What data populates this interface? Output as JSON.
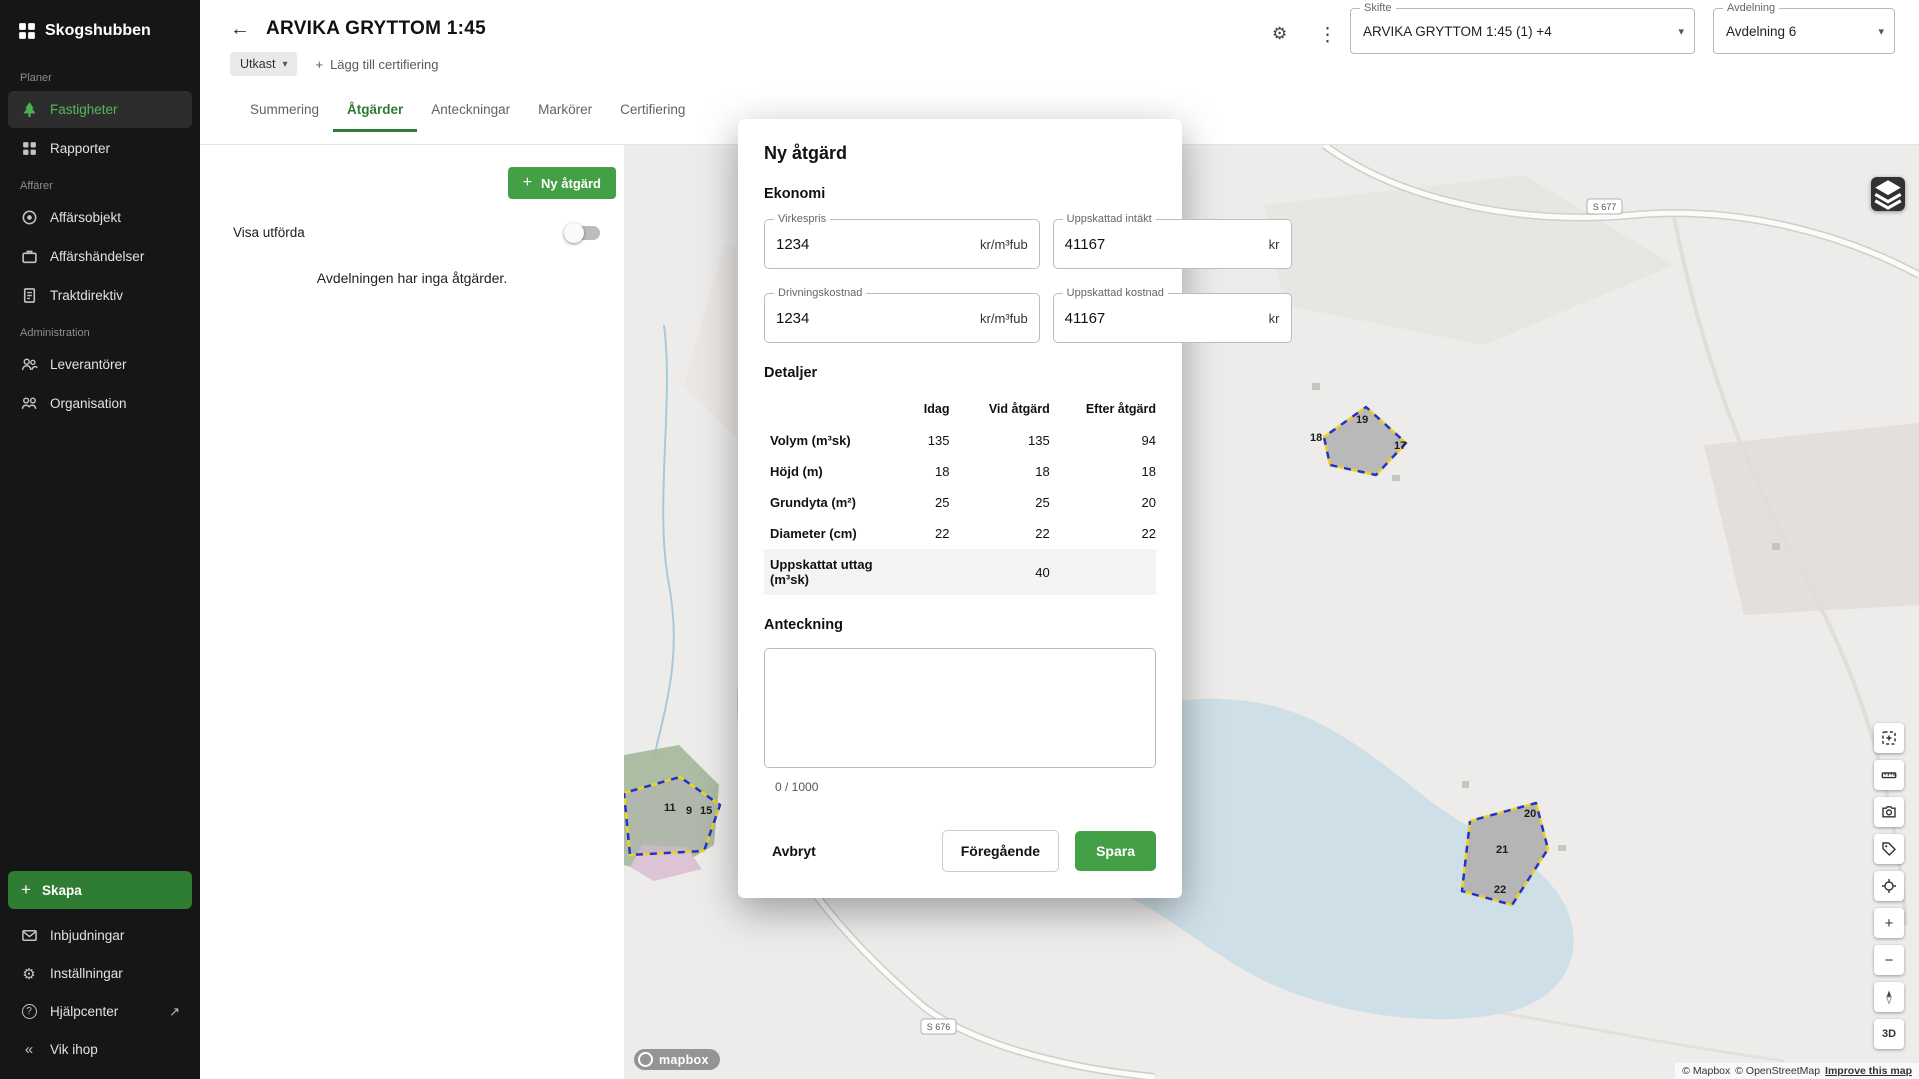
{
  "icons": {
    "back": "←",
    "more": "⋮",
    "gear": "⚙",
    "caret": "▾",
    "plus": "+",
    "collapse": "«",
    "external": "↗",
    "question": "?",
    "zoom_in": "+",
    "zoom_out": "−"
  },
  "sidebar": {
    "logo": "Skogshubben",
    "sections": [
      {
        "header": "Planer",
        "items": [
          {
            "label": "Fastigheter"
          },
          {
            "label": "Rapporter"
          }
        ]
      },
      {
        "header": "Affärer",
        "items": [
          {
            "label": "Affärsobjekt"
          },
          {
            "label": "Affärshändelser"
          },
          {
            "label": "Traktdirektiv"
          }
        ]
      },
      {
        "header": "Administration",
        "items": [
          {
            "label": "Leverantörer"
          },
          {
            "label": "Organisation"
          }
        ]
      }
    ],
    "create_button": "Skapa",
    "footer_items": [
      {
        "label": "Inbjudningar"
      },
      {
        "label": "Inställningar"
      },
      {
        "label": "Hjälpcenter"
      },
      {
        "label": "Vik ihop"
      }
    ]
  },
  "header": {
    "title": "ARVIKA GRYTTOM 1:45",
    "status": "Utkast",
    "add_certification": "Lägg till certifiering",
    "tabs": [
      {
        "label": "Summering"
      },
      {
        "label": "Åtgärder"
      },
      {
        "label": "Anteckningar"
      },
      {
        "label": "Markörer"
      },
      {
        "label": "Certifiering"
      }
    ],
    "skifte": {
      "label": "Skifte",
      "value": "ARVIKA GRYTTOM 1:45 (1) +4"
    },
    "avdelning": {
      "label": "Avdelning",
      "value": "Avdelning 6"
    }
  },
  "panel": {
    "new_action": "Ny åtgärd",
    "show_completed": "Visa utförda",
    "empty": "Avdelningen har inga åtgärder."
  },
  "modal": {
    "title": "Ny åtgärd",
    "economy": {
      "heading": "Ekonomi",
      "fields": [
        {
          "label": "Virkespris",
          "value": "1234",
          "unit": "kr/m³fub"
        },
        {
          "label": "Uppskattad intäkt",
          "value": "41167",
          "unit": "kr"
        },
        {
          "label": "Drivningskostnad",
          "value": "1234",
          "unit": "kr/m³fub"
        },
        {
          "label": "Uppskattad kostnad",
          "value": "41167",
          "unit": "kr"
        }
      ]
    },
    "details": {
      "heading": "Detaljer",
      "columns": [
        "Idag",
        "Vid åtgärd",
        "Efter åtgärd"
      ],
      "rows": [
        {
          "label": "Volym (m³sk)",
          "idag": "135",
          "vid": "135",
          "efter": "94"
        },
        {
          "label": "Höjd (m)",
          "idag": "18",
          "vid": "18",
          "efter": "18"
        },
        {
          "label": "Grundyta (m²)",
          "idag": "25",
          "vid": "25",
          "efter": "20"
        },
        {
          "label": "Diameter (cm)",
          "idag": "22",
          "vid": "22",
          "efter": "22"
        },
        {
          "label": "Uppskattat uttag (m³sk)",
          "idag": "",
          "vid": "40",
          "efter": ""
        }
      ]
    },
    "note": {
      "heading": "Anteckning",
      "counter": "0 / 1000"
    },
    "actions": {
      "cancel": "Avbryt",
      "previous": "Föregående",
      "save": "Spara"
    }
  },
  "map": {
    "shields": [
      "S 677",
      "S 676"
    ],
    "parcels": {
      "a": [
        "18",
        "19",
        "17"
      ],
      "b": [
        "20",
        "21",
        "22"
      ],
      "c": [
        "11",
        "9",
        "15"
      ]
    },
    "logo": "mapbox",
    "attribution": {
      "mapbox": "© Mapbox",
      "osm": "© OpenStreetMap",
      "improve": "Improve this map"
    },
    "controls": {
      "three_d": "3D"
    }
  }
}
